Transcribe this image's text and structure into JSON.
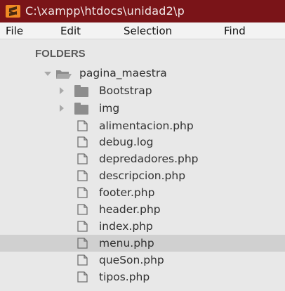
{
  "titlebar": {
    "title": "C:\\xampp\\htdocs\\unidad2\\p"
  },
  "menubar": {
    "items": [
      "File",
      "Edit",
      "Selection",
      "Find"
    ]
  },
  "sidebar": {
    "header": "FOLDERS",
    "root": "pagina_maestra",
    "folders": [
      "Bootstrap",
      "img"
    ],
    "files": [
      "alimentacion.php",
      "debug.log",
      "depredadores.php",
      "descripcion.php",
      "footer.php",
      "header.php",
      "index.php",
      "menu.php",
      "queSon.php",
      "tipos.php"
    ],
    "selected_file": "menu.php"
  },
  "icons": {
    "app": "sublime-text-icon",
    "folder_open": "folder-open-icon",
    "folder": "folder-icon",
    "file": "file-icon",
    "expand": "chevron-down-icon",
    "collapse": "chevron-right-icon"
  },
  "colors": {
    "titlebar_bg": "#7a1418",
    "app_icon": "#f08a24",
    "sidebar_bg": "#e8e8e8",
    "selected_row": "#d0d0d0",
    "icon_gray": "#8d8d8d"
  }
}
